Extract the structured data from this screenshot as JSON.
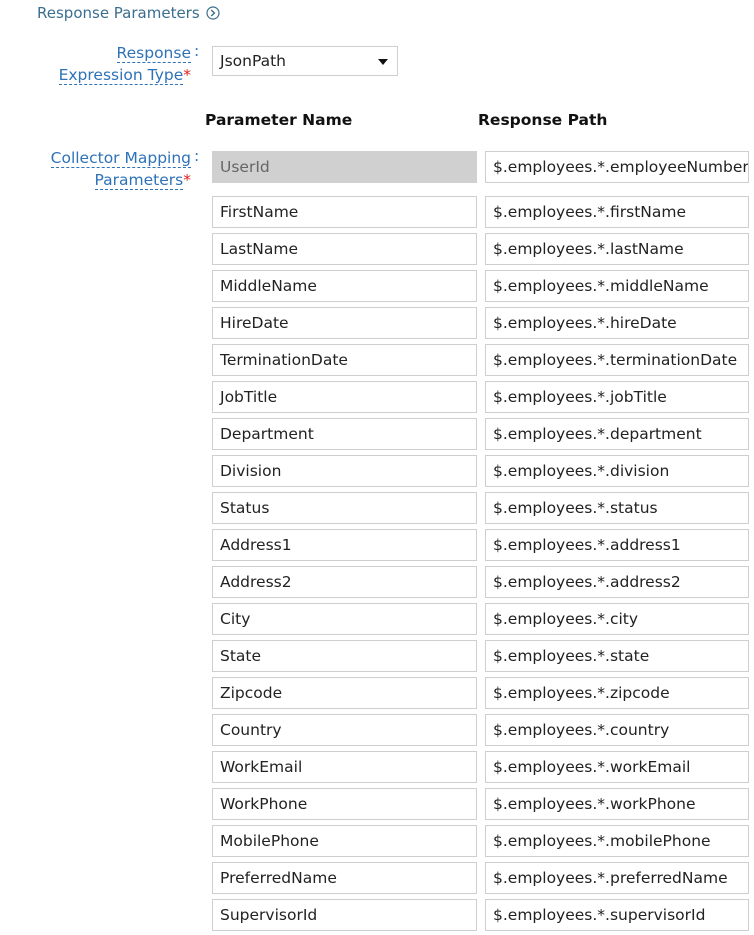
{
  "section": {
    "title": "Response Parameters",
    "icon": "chevron-circle-right-icon"
  },
  "expression_type": {
    "label_line1": "Response",
    "label_line2": "Expression Type",
    "required_mark": "*",
    "colon": ":",
    "selected": "JsonPath"
  },
  "columns": {
    "name_header": "Parameter Name",
    "path_header": "Response Path"
  },
  "collector": {
    "label_line1": "Collector Mapping",
    "label_line2": "Parameters",
    "required_mark": "*",
    "colon": ":"
  },
  "mappings": [
    {
      "name": "UserId",
      "path": "$.employees.*.employeeNumber",
      "disabled": true
    },
    {
      "name": "FirstName",
      "path": "$.employees.*.firstName"
    },
    {
      "name": "LastName",
      "path": "$.employees.*.lastName"
    },
    {
      "name": "MiddleName",
      "path": "$.employees.*.middleName"
    },
    {
      "name": "HireDate",
      "path": "$.employees.*.hireDate"
    },
    {
      "name": "TerminationDate",
      "path": "$.employees.*.terminationDate"
    },
    {
      "name": "JobTitle",
      "path": "$.employees.*.jobTitle"
    },
    {
      "name": "Department",
      "path": "$.employees.*.department"
    },
    {
      "name": "Division",
      "path": "$.employees.*.division"
    },
    {
      "name": "Status",
      "path": "$.employees.*.status"
    },
    {
      "name": "Address1",
      "path": "$.employees.*.address1"
    },
    {
      "name": "Address2",
      "path": "$.employees.*.address2"
    },
    {
      "name": "City",
      "path": "$.employees.*.city"
    },
    {
      "name": "State",
      "path": "$.employees.*.state"
    },
    {
      "name": "Zipcode",
      "path": "$.employees.*.zipcode"
    },
    {
      "name": "Country",
      "path": "$.employees.*.country"
    },
    {
      "name": "WorkEmail",
      "path": "$.employees.*.workEmail"
    },
    {
      "name": "WorkPhone",
      "path": "$.employees.*.workPhone"
    },
    {
      "name": "MobilePhone",
      "path": "$.employees.*.mobilePhone"
    },
    {
      "name": "PreferredName",
      "path": "$.employees.*.preferredName"
    },
    {
      "name": "SupervisorId",
      "path": "$.employees.*.supervisorId"
    }
  ]
}
